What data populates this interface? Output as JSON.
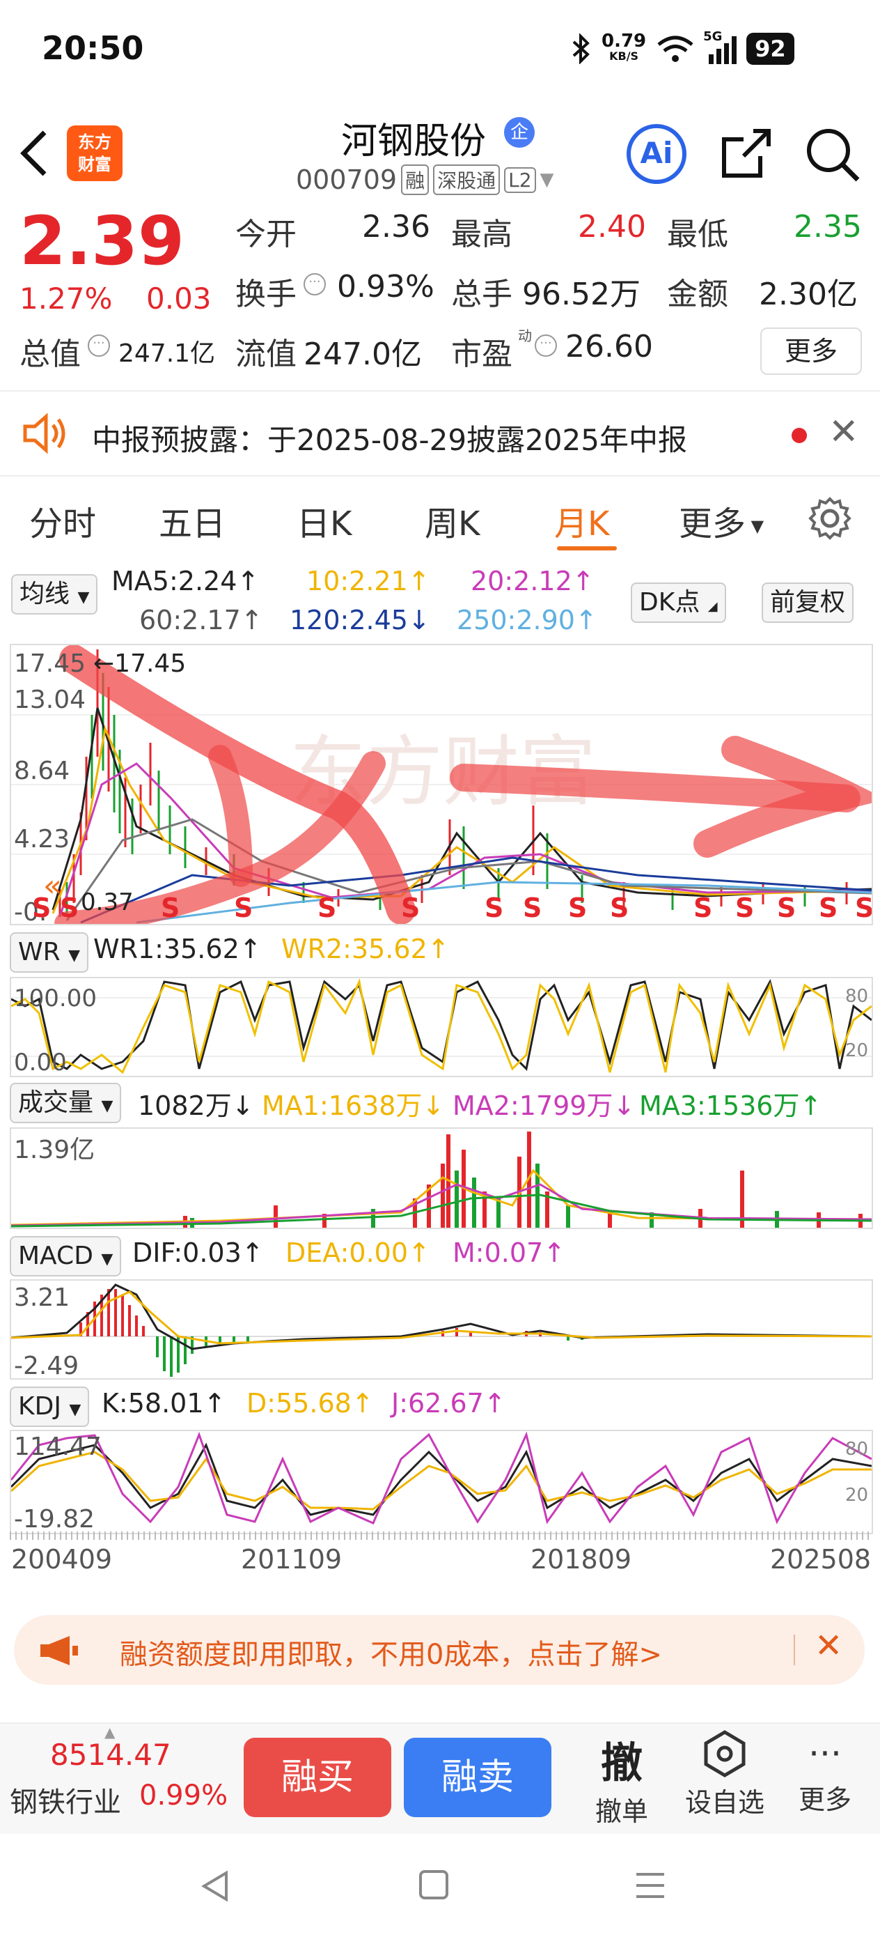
{
  "status": {
    "time": "20:50",
    "net_speed_top": "0.79",
    "net_speed_bottom": "KB/S",
    "network": "5G",
    "battery": "92"
  },
  "header": {
    "logo_line1": "东方",
    "logo_line2": "财富",
    "stock_name": "河钢股份",
    "qi_badge": "企",
    "stock_code": "000709",
    "tags": [
      "融",
      "深股通",
      "L2"
    ],
    "ai_label": "Ai"
  },
  "quote": {
    "price": "2.39",
    "change_pct": "1.27%",
    "change_amt": "0.03",
    "open_label": "今开",
    "open": "2.36",
    "high_label": "最高",
    "high": "2.40",
    "low_label": "最低",
    "low": "2.35",
    "turnover_label": "换手",
    "turnover": "0.93%",
    "volume_label": "总手",
    "volume": "96.52万",
    "amount_label": "金额",
    "amount": "2.30亿",
    "mcap_label": "总值",
    "mcap": "247.1亿",
    "float_label": "流值",
    "float_cap": "247.0亿",
    "pe_label": "市盈",
    "pe_sup": "动",
    "pe": "26.60",
    "more_label": "更多"
  },
  "notice": {
    "text": "中报预披露：于2025-08-29披露2025年中报"
  },
  "tabs": [
    "分时",
    "五日",
    "日K",
    "周K",
    "月K",
    "更多"
  ],
  "active_tab": "月K",
  "ma_bar": {
    "dropdown": "均线",
    "ma5": "MA5:2.24↑",
    "ma10": "10:2.21↑",
    "ma20": "20:2.12↑",
    "ma60": "60:2.17↑",
    "ma120": "120:2.45↓",
    "ma250": "250:2.90↑",
    "dk_button": "DK点",
    "adjust_button": "前复权"
  },
  "kline_axis": {
    "y1": "17.45",
    "y2": "13.04",
    "y3": "8.64",
    "y4": "4.23",
    "y5": "-0.",
    "high_marker": "←17.45",
    "low_marker": "0.37",
    "s_label": "S",
    "left_arrow": "«"
  },
  "wr": {
    "dropdown": "WR",
    "wr1": "WR1:35.62↑",
    "wr2": "WR2:35.62↑",
    "y_top": "100.00",
    "y_bottom": "0.00",
    "r1": "80",
    "r2": "20"
  },
  "volume_panel": {
    "dropdown": "成交量",
    "vol": "1082万↓",
    "ma1": "MA1:1638万↓",
    "ma2": "MA2:1799万↓",
    "ma3": "MA3:1536万↑",
    "y_top": "1.39亿"
  },
  "macd": {
    "dropdown": "MACD",
    "dif": "DIF:0.03↑",
    "dea": "DEA:0.00↑",
    "m": "M:0.07↑",
    "y_top": "3.21",
    "y_bottom": "-2.49"
  },
  "kdj": {
    "dropdown": "KDJ",
    "k": "K:58.01↑",
    "d": "D:55.68↑",
    "j": "J:62.67↑",
    "y_top": "114.47",
    "y_bottom": "-19.82",
    "r1": "80",
    "r2": "20"
  },
  "x_axis": [
    "200409",
    "201109",
    "201809",
    "202508"
  ],
  "promo": {
    "text": "融资额度即用即取，不用0成本，点击了解>"
  },
  "bottom": {
    "index_value": "8514.47",
    "index_name": "钢铁行业",
    "index_pct": "0.99%",
    "buy": "融买",
    "sell": "融卖",
    "cancel_big": "撤",
    "cancel": "撤单",
    "watch": "设自选",
    "more": "更多"
  },
  "colors": {
    "up": "#e4262b",
    "down": "#18a030",
    "accent": "#f0701a",
    "ma10": "#f0b400",
    "ma20": "#c83cb8",
    "ma120": "#1a3c9a",
    "ma250": "#60b0e0"
  }
}
